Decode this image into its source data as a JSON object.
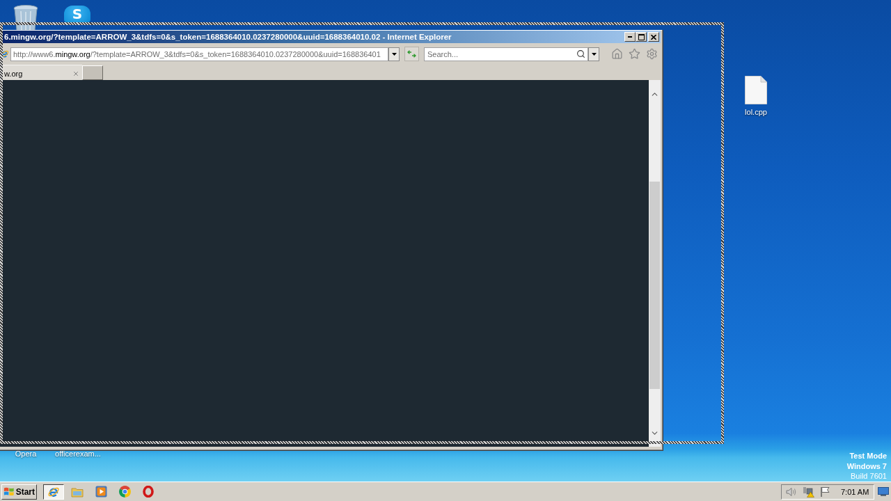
{
  "desktop": {
    "logo_letter": "S",
    "covered_icon_labels": [
      "Opera",
      "officerexam..."
    ],
    "file_icons": [
      {
        "label": "lol.cpp"
      }
    ],
    "system_notice": [
      "Test Mode",
      "Windows 7",
      "Build 7601"
    ]
  },
  "browser_window": {
    "title": "6.mingw.org/?template=ARROW_3&tdfs=0&s_token=1688364010.0237280000&uuid=1688364010.02 - Internet Explorer",
    "address": {
      "prefix": "http://www6.",
      "domain": "mingw.org",
      "rest": "/?template=ARROW_3&tdfs=0&s_token=1688364010.0237280000&uuid=168836401"
    },
    "search": {
      "placeholder": "Search..."
    },
    "tabs": [
      {
        "label": "w.org",
        "selected": true
      }
    ]
  },
  "taskbar": {
    "start_label": "Start",
    "pinned": [
      {
        "active": true
      },
      {
        "active": false
      },
      {
        "active": false
      },
      {
        "active": false
      },
      {
        "active": false
      }
    ],
    "clock": "7:01 AM"
  }
}
